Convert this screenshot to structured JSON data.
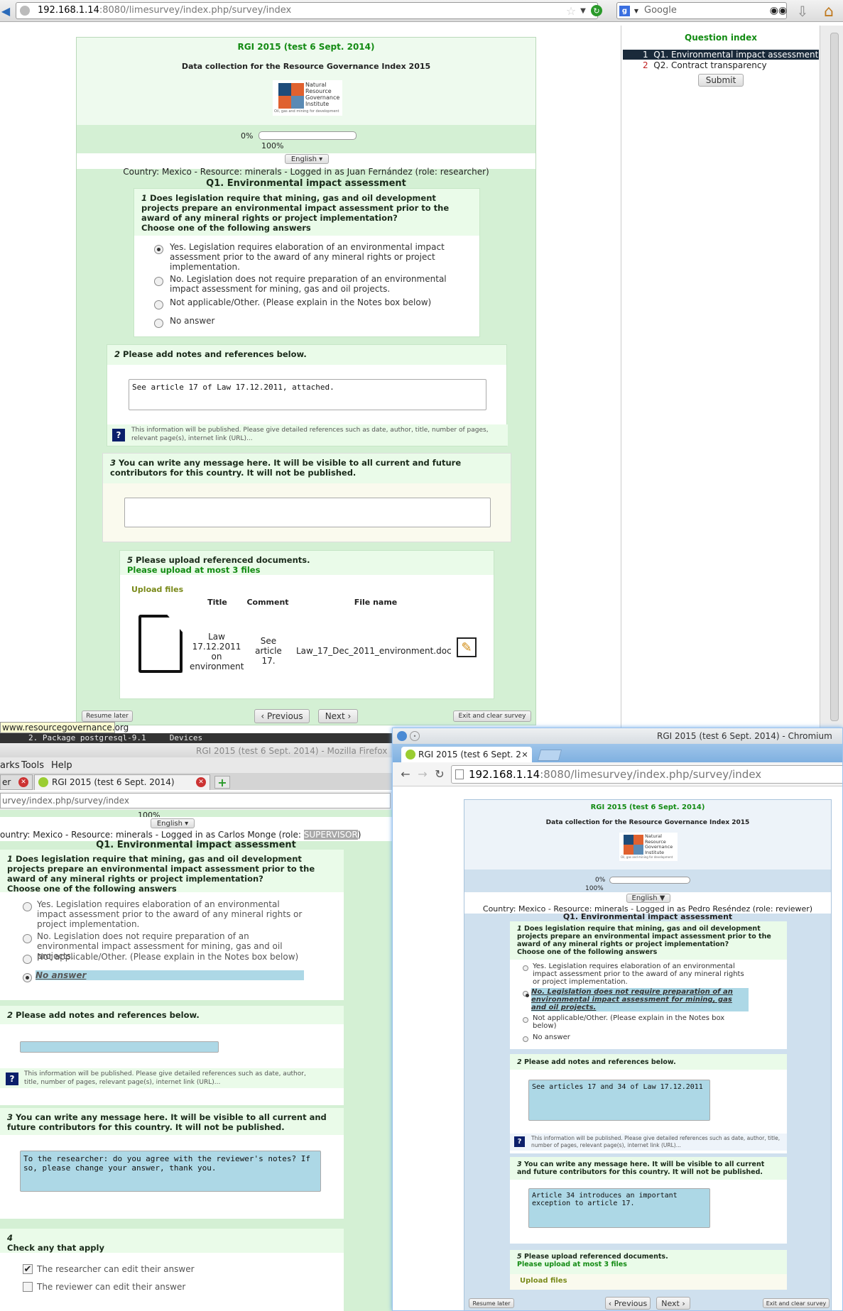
{
  "firefox_top": {
    "url": "192.168.1.14:8080/limesurvey/index.php/survey/index",
    "url_host": "192.168.1.14",
    "url_rest": ":8080/limesurvey/index.php/survey/index",
    "search_placeholder": "Google",
    "status_url": "www.resourcegovernance.org"
  },
  "survey": {
    "title": "RGI 2015 (test 6 Sept. 2014)",
    "description": "Data collection for the Resource Governance Index 2015",
    "logo_lines": [
      "Natural",
      "Resource",
      "Governance",
      "Institute"
    ],
    "logo_tagline": "Oil, gas and mining for development",
    "progress_start": "0%",
    "progress_end": "100%",
    "progress_value": 0,
    "language": "English",
    "group_title": "Q1. Environmental impact assessment"
  },
  "main": {
    "context": "Country: Mexico - Resource: minerals - Logged in as Juan Fernández (role: researcher)",
    "q1": {
      "num": "1",
      "text": "Does legislation require that mining, gas and oil development projects prepare an environmental impact assessment prior to the award of any mineral rights or project implementation?",
      "instruction": "Choose one of the following answers",
      "options": [
        "Yes. Legislation requires elaboration of an environmental impact assessment prior to the award of any mineral rights or project implementation.",
        "No. Legislation does not require preparation of an environmental impact assessment for mining, gas and oil projects.",
        "Not applicable/Other. (Please explain in the Notes box below)",
        "No answer"
      ],
      "selected": 0
    },
    "q2": {
      "num": "2",
      "text": "Please add notes and references below.",
      "value": "See article 17 of Law 17.12.2011, attached.",
      "help": "This information will be published. Please give detailed references such as date, author, title, number of pages, relevant page(s), internet link (URL)..."
    },
    "q3": {
      "num": "3",
      "text": "You can write any message here. It will be visible to all current and future contributors for this country. It will not be published.",
      "value": ""
    },
    "q5": {
      "num": "5",
      "text": "Please upload referenced documents.",
      "limit": "Please upload at most 3 files",
      "upload_label": "Upload files",
      "columns": [
        "Title",
        "Comment",
        "File name"
      ],
      "file": {
        "title": "Law 17.12.2011 on environment",
        "title_lines": [
          "Law",
          "17.12.2011",
          "on",
          "environment"
        ],
        "comment": "See article 17.",
        "comment_lines": [
          "See",
          "article",
          "17."
        ],
        "name": "Law_17_Dec_2011_environment.doc"
      }
    },
    "buttons": {
      "resume": "Resume later",
      "previous": "Previous",
      "next": "Next",
      "exit": "Exit and clear survey"
    }
  },
  "question_index": {
    "title": "Question index",
    "items": [
      {
        "num": "1",
        "label": "Q1. Environmental impact assessment",
        "active": true
      },
      {
        "num": "2",
        "label": "Q2. Contract transparency",
        "active": false
      }
    ],
    "submit": "Submit"
  },
  "firefox_bottom": {
    "terminal_text": "2. Package postgresql-9.1",
    "devices": "Devices",
    "window_title": "RGI 2015 (test 6 Sept. 2014) - Mozilla Firefox",
    "menu": [
      "arks",
      "Tools",
      "Help"
    ],
    "tab_left": "er",
    "tab_active": "RGI 2015 (test 6 Sept. 2014)",
    "url": "urvey/index.php/survey/index",
    "progress_end": "100%",
    "language": "English",
    "context_pre": "ountry: Mexico - Resource: minerals - Logged in as Carlos Monge (role: ",
    "role": "SUPERVISOR",
    "context_post": ")",
    "q1_selected": 3,
    "q2_value": "",
    "q3_value": "To the researcher: do you agree with the reviewer's notes? If so, please change your answer, thank you.",
    "q4": {
      "num": "4",
      "text": "Check any that apply",
      "options": [
        "The researcher can edit their answer",
        "The reviewer can edit their answer"
      ],
      "checked": [
        true,
        false
      ]
    }
  },
  "chromium": {
    "window_title": "RGI 2015 (test 6 Sept. 2014) - Chromium",
    "tab_title": "RGI 2015 (test 6 Sept. 2",
    "url": "192.168.1.14:8080/limesurvey/index.php/survey/index",
    "url_host": "192.168.1.14",
    "url_rest": ":8080/limesurvey/index.php/survey/index",
    "context": "Country: Mexico - Resource: minerals - Logged in as Pedro Reséndez (role: reviewer)",
    "q1_selected": 1,
    "q1_options": [
      "Yes. Legislation requires elaboration of an environmental impact assessment prior to the award of any mineral rights or project implementation.",
      "No. Legislation does not require preparation of an environmental impact assessment for mining, gas and oil projects.",
      "Not applicable/Other. (Please explain in the Notes box below)",
      "No answer"
    ],
    "q2_value": "See articles 17 and 34 of Law 17.12.2011",
    "q3_value": "Article 34 introduces an important exception to article 17."
  }
}
